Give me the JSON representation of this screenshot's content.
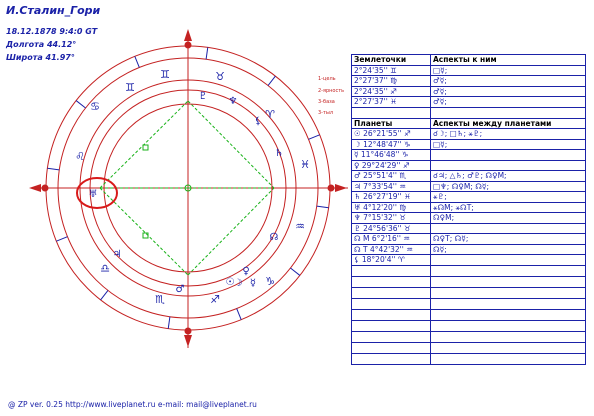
{
  "header": {
    "title": "И.Сталин_Гори",
    "datetime": "18.12.1878 9:4:0 GT",
    "longitude": "Долгота 44.12°",
    "latitude": "Широта 41.97°"
  },
  "wheel_labels": [
    "1-цель",
    "2-ярность",
    "3-база",
    "3-тыл"
  ],
  "points_table": {
    "col1": "Землеточки",
    "col2": "Аспекты к ним",
    "rows": [
      {
        "pos": "2°24'35'' ♊",
        "asp": "□☿;"
      },
      {
        "pos": "2°27'37'' ♍",
        "asp": "♂☿;"
      },
      {
        "pos": "2°24'35'' ♐",
        "asp": "♂☿;"
      },
      {
        "pos": "2°27'37'' ♓",
        "asp": "♂☿;"
      }
    ]
  },
  "planets_table": {
    "col1": "Планеты",
    "col2": "Аспекты между планетами",
    "rows": [
      {
        "pos": "☉ 26°21'55'' ♐",
        "asp": "☌☽; □♄; ⚹♇;"
      },
      {
        "pos": "☽ 12°48'47'' ♑",
        "asp": "□☿;"
      },
      {
        "pos": "☿ 11°46'48'' ♑",
        "asp": ""
      },
      {
        "pos": "♀ 29°24'29'' ♐",
        "asp": ""
      },
      {
        "pos": "♂ 25°51'4'' ♏",
        "asp": "☌♃; △♄; ♂♇; ☊♀M;"
      },
      {
        "pos": "♃ 7°33'54'' ♒",
        "asp": "□♆; ☊♀M; ☊☿;"
      },
      {
        "pos": "♄ 26°27'19'' ♓",
        "asp": "⚹♇;"
      },
      {
        "pos": "♅ 4°12'20'' ♍",
        "asp": "⚹☊M; ⚹☊T;"
      },
      {
        "pos": "♆ 7°15'32'' ♉",
        "asp": "☊♀M;"
      },
      {
        "pos": "♇ 24°56'36'' ♉",
        "asp": ""
      },
      {
        "pos": "☊ M 6°2'16'' ♒",
        "asp": "☊♀T; ☊☿;"
      },
      {
        "pos": "☊ T 4°42'32'' ♒",
        "asp": "☊☿;"
      },
      {
        "pos": "⚸ 18°20'4'' ♈",
        "asp": ""
      }
    ]
  },
  "footer": "@ ZP  ver. 0.25 http://www.liveplanet.ru  e-mail: mail@liveplanet.ru",
  "colors": {
    "ink": "#1b22a8",
    "circle": "#c42222",
    "aspect": "#19b219"
  },
  "icons": [
    "sun-icon",
    "moon-icon",
    "mercury-icon",
    "venus-icon",
    "mars-icon",
    "jupiter-icon",
    "saturn-icon",
    "uranus-icon",
    "neptune-icon",
    "pluto-icon",
    "node-icon",
    "lilith-icon",
    "arrow-icon"
  ]
}
